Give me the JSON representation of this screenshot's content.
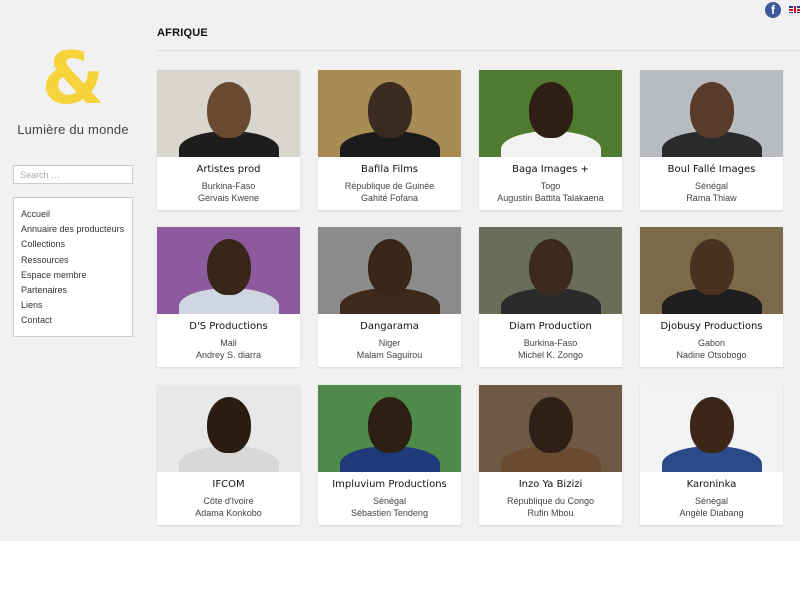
{
  "logo": {
    "mark": "&",
    "text": "Lumière du monde"
  },
  "social": {
    "facebook_icon": "f"
  },
  "search": {
    "placeholder": "Search …"
  },
  "nav": {
    "items": [
      "Accueil",
      "Annuaire des producteurs",
      "Collections",
      "Ressources",
      "Espace membre",
      "Partenaires",
      "Liens",
      "Contact"
    ]
  },
  "page": {
    "title": "AFRIQUE"
  },
  "cards": [
    {
      "name": "Artistes prod",
      "country": "Burkina-Faso",
      "person": "Gervais Kwene",
      "bg": "#d9d6cf",
      "skin": "#6b4a32",
      "cloth": "#1d1d1d"
    },
    {
      "name": "Bafila Films",
      "country": "République de Guinée",
      "person": "Gahité Fofana",
      "bg": "#a88a55",
      "skin": "#3a2a1f",
      "cloth": "#1a1a1a"
    },
    {
      "name": "Baga Images +",
      "country": "Togo",
      "person": "Augustin Battita Talakaena",
      "bg": "#4f7a2f",
      "skin": "#2e1e14",
      "cloth": "#f2f2f2"
    },
    {
      "name": "Boul Fallé Images",
      "country": "Sénégal",
      "person": "Rama Thiaw",
      "bg": "#b8bcc0",
      "skin": "#5a3a28",
      "cloth": "#2a2a2a"
    },
    {
      "name": "D'S Productions",
      "country": "Mali",
      "person": "Andrey S. diarra",
      "bg": "#8e5a9e",
      "skin": "#3a2618",
      "cloth": "#cfd6e2"
    },
    {
      "name": "Dangarama",
      "country": "Niger",
      "person": "Malam Saguirou",
      "bg": "#8c8c8c",
      "skin": "#3b2719",
      "cloth": "#3d2a1a"
    },
    {
      "name": "Diam Production",
      "country": "Burkina-Faso",
      "person": "Michel K. Zongo",
      "bg": "#6a6e58",
      "skin": "#3c2a1c",
      "cloth": "#2b2b2b"
    },
    {
      "name": "Djobusy Productions",
      "country": "Gabon",
      "person": "Nadine Otsobogo",
      "bg": "#7a6a4a",
      "skin": "#4a3020",
      "cloth": "#1f1f1f"
    },
    {
      "name": "IFCOM",
      "country": "Côte d'Ivoire",
      "person": "Adama Konkobo",
      "bg": "#e8e8e8",
      "skin": "#2b1c12",
      "cloth": "#d8d8d8"
    },
    {
      "name": "Impluvium Productions",
      "country": "Sénégal",
      "person": "Sébastien Tendeng",
      "bg": "#4f8a4a",
      "skin": "#2e1f14",
      "cloth": "#1f3a7a"
    },
    {
      "name": "Inzo Ya Bizizi",
      "country": "République du Congo",
      "person": "Rufin Mbou",
      "bg": "#6e5a44",
      "skin": "#2e2017",
      "cloth": "#6a4a30"
    },
    {
      "name": "Karoninka",
      "country": "Sénégal",
      "person": "Angèle Diabang",
      "bg": "#f2f2f2",
      "skin": "#3b2618",
      "cloth": "#2a4a8a"
    }
  ],
  "colors": {
    "logo_yellow": "#f6d33a",
    "facebook_blue": "#3b5998"
  },
  "icons": [
    "facebook-icon",
    "uk-flag-icon"
  ]
}
